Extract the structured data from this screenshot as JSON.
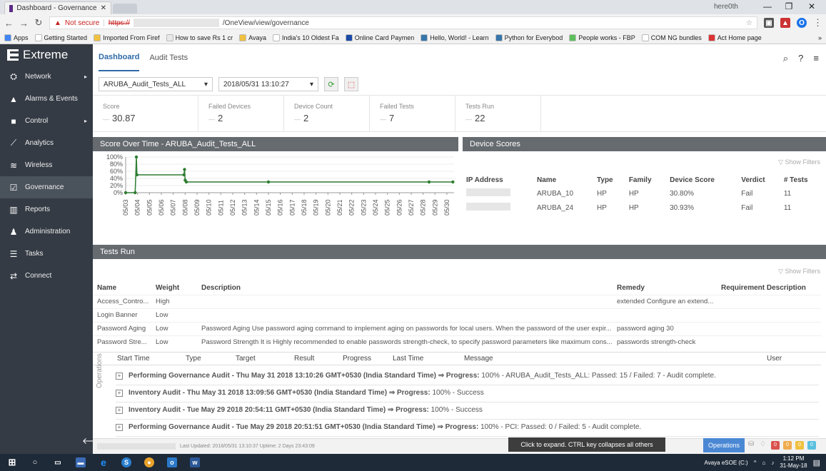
{
  "browser": {
    "tab_title": "Dashboard - Governance",
    "profile_label": "here0th",
    "url_warning": "Not secure",
    "url_scheme": "https://",
    "url_path": "/OneView/view/governance",
    "bookmarks": [
      {
        "label": "Apps",
        "color": "#4285f4"
      },
      {
        "label": "Getting Started",
        "color": "#ffffff"
      },
      {
        "label": "Imported From Firef",
        "color": "#f0c040"
      },
      {
        "label": "How to save Rs 1 cr",
        "color": "#e8e8e8"
      },
      {
        "label": "Avaya",
        "color": "#f0c040"
      },
      {
        "label": "India's 10 Oldest Fa",
        "color": "#ffffff"
      },
      {
        "label": "Online Card Paymen",
        "color": "#1a4aa8"
      },
      {
        "label": "Hello, World! - Learn",
        "color": "#3776ab"
      },
      {
        "label": "Python for Everybod",
        "color": "#3776ab"
      },
      {
        "label": "People works - FBP",
        "color": "#5bbf5b"
      },
      {
        "label": "COM NG bundles",
        "color": "#ffffff"
      },
      {
        "label": "Act Home page",
        "color": "#d33"
      }
    ]
  },
  "app": {
    "brand": "Extreme",
    "nav": [
      {
        "label": "Network",
        "icon": "network-icon",
        "caret": true
      },
      {
        "label": "Alarms & Events",
        "icon": "bell-icon",
        "caret": false
      },
      {
        "label": "Control",
        "icon": "lock-icon",
        "caret": true
      },
      {
        "label": "Analytics",
        "icon": "analytics-icon",
        "caret": false
      },
      {
        "label": "Wireless",
        "icon": "wireless-icon",
        "caret": false
      },
      {
        "label": "Governance",
        "icon": "governance-icon",
        "caret": false,
        "active": true
      },
      {
        "label": "Reports",
        "icon": "reports-icon",
        "caret": false
      },
      {
        "label": "Administration",
        "icon": "administration-icon",
        "caret": false
      },
      {
        "label": "Tasks",
        "icon": "tasks-icon",
        "caret": false
      },
      {
        "label": "Connect",
        "icon": "connect-icon",
        "caret": false
      }
    ],
    "tabs": [
      "Dashboard",
      "Audit Tests"
    ],
    "audit_select": "ARUBA_Audit_Tests_ALL",
    "date_select": "2018/05/31 13:10:27"
  },
  "stats": [
    {
      "label": "Score",
      "value": "30.87"
    },
    {
      "label": "Failed Devices",
      "value": "2"
    },
    {
      "label": "Device Count",
      "value": "2"
    },
    {
      "label": "Failed Tests",
      "value": "7"
    },
    {
      "label": "Tests Run",
      "value": "22"
    }
  ],
  "chart_data": {
    "type": "line",
    "title": "Score Over Time - ARUBA_Audit_Tests_ALL",
    "x": [
      "05/03",
      "05/04",
      "05/05",
      "05/06",
      "05/07",
      "05/08",
      "05/09",
      "05/10",
      "05/11",
      "05/12",
      "05/13",
      "05/14",
      "05/15",
      "05/16",
      "05/17",
      "05/18",
      "05/19",
      "05/20",
      "05/21",
      "05/22",
      "05/23",
      "05/24",
      "05/25",
      "05/26",
      "05/27",
      "05/28",
      "05/29",
      "05/30"
    ],
    "y_ticks": [
      "100%",
      "80%",
      "60%",
      "40%",
      "20%",
      "0%"
    ],
    "ylim": [
      0,
      100
    ],
    "points": [
      {
        "x": 0,
        "y": 0
      },
      {
        "x": 0.8,
        "y": 0
      },
      {
        "x": 0.9,
        "y": 100
      },
      {
        "x": 0.95,
        "y": 50
      },
      {
        "x": 4.9,
        "y": 50
      },
      {
        "x": 4.95,
        "y": 65
      },
      {
        "x": 5.0,
        "y": 35
      },
      {
        "x": 5.1,
        "y": 30
      },
      {
        "x": 12.0,
        "y": 30
      },
      {
        "x": 25.5,
        "y": 30
      },
      {
        "x": 27.5,
        "y": 30
      }
    ]
  },
  "device_scores": {
    "title": "Device Scores",
    "show_filters": "Show Filters",
    "columns": [
      "IP Address",
      "Name",
      "Type",
      "Family",
      "Device Score",
      "Verdict",
      "# Tests"
    ],
    "rows": [
      {
        "name": "ARUBA_10",
        "type": "HP",
        "family": "HP",
        "score": "30.80%",
        "verdict": "Fail",
        "tests": "11"
      },
      {
        "name": "ARUBA_24",
        "type": "HP",
        "family": "HP",
        "score": "30.93%",
        "verdict": "Fail",
        "tests": "11"
      }
    ]
  },
  "tests_run": {
    "title": "Tests Run",
    "show_filters": "Show Filters",
    "columns": [
      "Name",
      "Weight",
      "Description",
      "Remedy",
      "Requirement Description"
    ],
    "rows": [
      {
        "name": "Access_Contro...",
        "weight": "High",
        "description": "",
        "remedy": "extended Configure an extend..."
      },
      {
        "name": "Login Banner",
        "weight": "Low",
        "description": "",
        "remedy": ""
      },
      {
        "name": "Password Aging",
        "weight": "Low",
        "description": "Password Aging Use password aging command to implement aging on passwords for local users. When the password of the user expir...",
        "remedy": "password aging 30"
      },
      {
        "name": "Password Stre...",
        "weight": "Low",
        "description": "Password Strength It is Highly recommended to enable passwords strength-check, to specify password parameters like maximum cons...",
        "remedy": "passwords strength-check"
      }
    ]
  },
  "operations": {
    "label": "Operations",
    "columns": [
      "Start Time",
      "Type",
      "Target",
      "Result",
      "Progress",
      "Last Time",
      "Message",
      "User"
    ],
    "rows": [
      {
        "bold": "Performing Governance Audit - Thu May 31 2018 13:10:26 GMT+0530 (India Standard Time) ⇒ Progress:",
        "rest": " 100% - ARUBA_Audit_Tests_ALL: Passed: 15 / Failed: 7 - Audit complete."
      },
      {
        "bold": "Inventory Audit - Thu May 31 2018 13:09:56 GMT+0530 (India Standard Time) ⇒ Progress:",
        "rest": " 100% - Success"
      },
      {
        "bold": "Inventory Audit - Tue May 29 2018 20:54:11 GMT+0530 (India Standard Time) ⇒ Progress:",
        "rest": " 100% - Success"
      },
      {
        "bold": "Performing Governance Audit - Tue May 29 2018 20:51:51 GMT+0530 (India Standard Time) ⇒ Progress:",
        "rest": " 100% - PCI: Passed: 0 / Failed: 5 - Audit complete."
      }
    ]
  },
  "statusbar": {
    "text": "Last Updated: 2018/05/31 13:10:37   Uptime: 2 Days 23:43:09",
    "tooltip": "Click to expand. CTRL key collapses all others",
    "operations_button": "Operations",
    "alert_counts": [
      "0",
      "0",
      "0",
      "0"
    ],
    "alert_colors": [
      "#d9534f",
      "#f0ad4e",
      "#f0c040",
      "#5bc0de"
    ]
  },
  "taskbar": {
    "drive_label": "Avaya eSOE (C:)",
    "time": "1:12 PM",
    "date": "31-May-18"
  }
}
